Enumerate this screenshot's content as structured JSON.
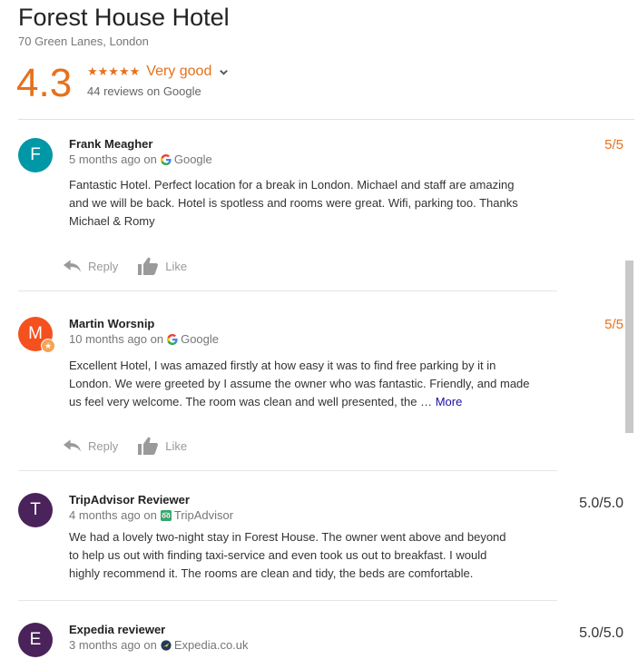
{
  "hotel": {
    "name": "Forest House Hotel",
    "address": "70 Green Lanes, London",
    "rating": "4.3",
    "stars_rating": 4.3,
    "stars": "★★★★★",
    "rating_word": "Very good",
    "review_count": "44 reviews on Google"
  },
  "colors": {
    "accent": "#e7711b",
    "link": "#1a0dab"
  },
  "actions": {
    "reply": "Reply",
    "like": "Like"
  },
  "reviews": [
    {
      "initial": "F",
      "avatar_color": "#0097a7",
      "name": "Frank Meagher",
      "time": "5 months ago on",
      "source": "Google",
      "source_icon": "google-icon",
      "score": "5/5",
      "text": "Fantastic Hotel. Perfect location for a break in London. Michael and staff are amazing and we will be back. Hotel is spotless and rooms were great. Wifi, parking too. Thanks Michael & Romy"
    },
    {
      "initial": "M",
      "avatar_color": "#f4511e",
      "local_guide": true,
      "name": "Martin Worsnip",
      "time": "10 months ago on",
      "source": "Google",
      "source_icon": "google-icon",
      "score": "5/5",
      "text": "Excellent Hotel, I was amazed firstly at how easy it was to find free parking by it in London. We were greeted by I assume the owner who was fantastic. Friendly, and made us feel very welcome. The room was clean and well presented, the …",
      "more": "More"
    },
    {
      "initial": "T",
      "avatar_color": "#4a235a",
      "name": "TripAdvisor Reviewer",
      "time": "4 months ago on",
      "source": "TripAdvisor",
      "source_icon": "tripadvisor-icon",
      "score": "5.0/5.0",
      "text": "We had a lovely two-night stay in Forest House. The owner went above and beyond to help us out with finding taxi-service and even took us out to breakfast. I would highly recommend it. The rooms are clean and tidy, the beds are comfortable."
    },
    {
      "initial": "E",
      "avatar_color": "#4a235a",
      "name": "Expedia reviewer",
      "time": "3 months ago on",
      "source": "Expedia.co.uk",
      "source_icon": "expedia-icon",
      "score": "5.0/5.0"
    }
  ]
}
